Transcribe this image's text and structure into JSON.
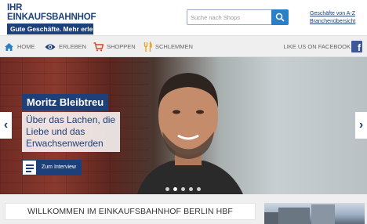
{
  "header": {
    "logo_top": "IHR EINKAUFSBAHNHOF",
    "logo_bottom": "Gute Geschäfte. Mehr erleben.",
    "search_placeholder": "Suche nach Shops",
    "link_shops": "Geschäfte von A-Z",
    "link_branches": "Branchenübersicht"
  },
  "nav": {
    "items": [
      {
        "label": "HOME",
        "icon": "home-icon"
      },
      {
        "label": "ERLEBEN",
        "icon": "eye-icon"
      },
      {
        "label": "SHOPPEN",
        "icon": "cart-icon"
      },
      {
        "label": "SCHLEMMEN",
        "icon": "cutlery-icon"
      }
    ],
    "facebook_label": "LIKE US ON FACEBOOK"
  },
  "hero": {
    "name": "Moritz Bleibtreu",
    "text": "Über das Lachen, die Liebe und das Erwachsenwerden",
    "button_label": "Zum Interview",
    "slide_count": 5,
    "active_slide": 1
  },
  "welcome": {
    "title": "WILLKOMMEN IM EINKAUFSBAHNHOF BERLIN HBF"
  },
  "colors": {
    "brand_blue": "#1d3f7a",
    "search_button": "#2a7fc7",
    "facebook": "#3b5998",
    "nav_background": "#efefef"
  }
}
